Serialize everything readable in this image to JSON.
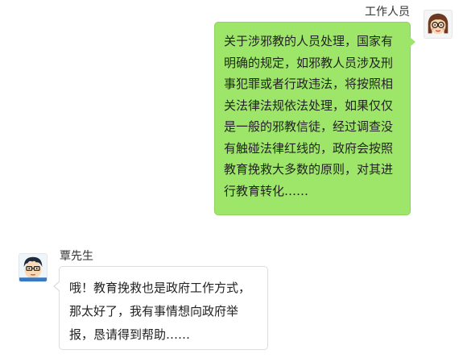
{
  "conversation": {
    "messages": [
      {
        "sender": "工作人员",
        "side": "right",
        "avatar_icon": "cartoon-woman-glasses-icon",
        "bubble_color": "#9ee66a",
        "text": "关于涉邪教的人员处理，国家有明确的规定，如邪教人员涉及刑事犯罪或者行政违法，将按照相关法律法规依法处理，如果仅仅是一般的邪教信徒，经过调查没有触碰法律红线的，政府会按照教育挽救大多数的原则，对其进行教育转化……"
      },
      {
        "sender": "覃先生",
        "side": "left",
        "avatar_icon": "cartoon-man-glasses-icon",
        "bubble_color": "#ffffff",
        "text": "哦！教育挽救也是政府工作方式，那太好了，我有事情想向政府举报，恳请得到帮助……"
      }
    ]
  }
}
